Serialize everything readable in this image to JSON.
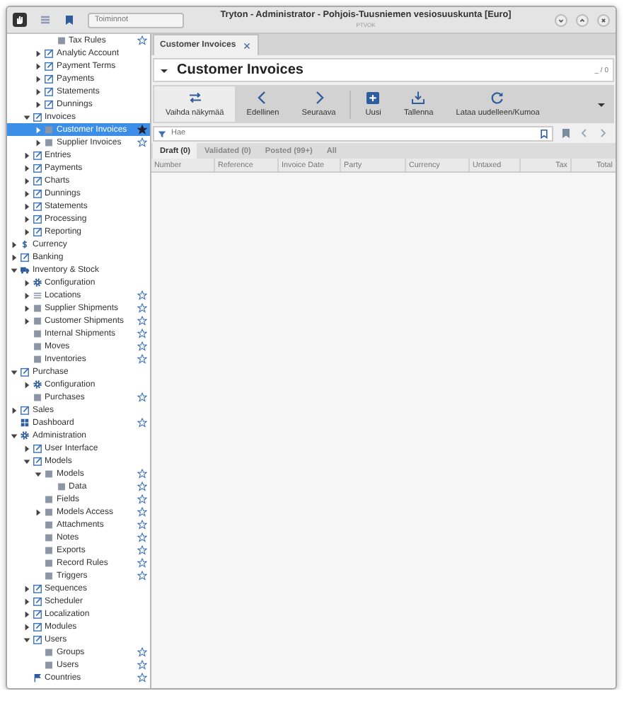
{
  "window": {
    "title": "Tryton - Administrator - Pohjois-Tuusniemen vesiosuuskunta [Euro]",
    "subtitle": "PTVOK",
    "search": {
      "placeholder": "Toiminnot"
    }
  },
  "sidebar": {
    "tree": [
      {
        "children": [
          {
            "children": [
              {
                "children": [
                  {
                    "label": "Tax Rules",
                    "kind": "list",
                    "selected": false,
                    "favorite": false
                  }
                ]
              },
              {
                "label": "Analytic Account",
                "kind": "form",
                "expanded": false,
                "selected": false
              },
              {
                "label": "Payment Terms",
                "kind": "form",
                "expanded": false,
                "selected": false
              },
              {
                "label": "Payments",
                "kind": "form",
                "expanded": false,
                "selected": false
              },
              {
                "label": "Statements",
                "kind": "form",
                "expanded": false,
                "selected": false
              },
              {
                "label": "Dunnings",
                "kind": "form",
                "expanded": false,
                "selected": false
              }
            ]
          },
          {
            "label": "Invoices",
            "kind": "form",
            "expanded": true,
            "selected": false,
            "children": [
              {
                "label": "Customer Invoices",
                "kind": "list",
                "expanded": false,
                "selected": true,
                "favorite": true
              },
              {
                "label": "Supplier Invoices",
                "kind": "list",
                "expanded": false,
                "selected": false,
                "favorite": false
              }
            ]
          },
          {
            "label": "Entries",
            "kind": "form",
            "expanded": false,
            "selected": false
          },
          {
            "label": "Payments",
            "kind": "form",
            "expanded": false,
            "selected": false
          },
          {
            "label": "Charts",
            "kind": "form",
            "expanded": false,
            "selected": false
          },
          {
            "label": "Dunnings",
            "kind": "form",
            "expanded": false,
            "selected": false
          },
          {
            "label": "Statements",
            "kind": "form",
            "expanded": false,
            "selected": false
          },
          {
            "label": "Processing",
            "kind": "form",
            "expanded": false,
            "selected": false
          },
          {
            "label": "Reporting",
            "kind": "form",
            "expanded": false,
            "selected": false
          }
        ]
      },
      {
        "label": "Currency",
        "kind": "dollar",
        "expanded": false,
        "selected": false
      },
      {
        "label": "Banking",
        "kind": "form",
        "expanded": false,
        "selected": false
      },
      {
        "label": "Inventory & Stock",
        "kind": "truck",
        "expanded": true,
        "selected": false,
        "children": [
          {
            "label": "Configuration",
            "kind": "gear",
            "expanded": false,
            "selected": false
          },
          {
            "label": "Locations",
            "kind": "lines",
            "expanded": false,
            "selected": false,
            "favorite": false
          },
          {
            "label": "Supplier Shipments",
            "kind": "list",
            "expanded": false,
            "selected": false,
            "favorite": false
          },
          {
            "label": "Customer Shipments",
            "kind": "list",
            "expanded": false,
            "selected": false,
            "favorite": false
          },
          {
            "label": "Internal Shipments",
            "kind": "list",
            "selected": false,
            "favorite": false
          },
          {
            "label": "Moves",
            "kind": "list",
            "selected": false,
            "favorite": false
          },
          {
            "label": "Inventories",
            "kind": "list",
            "selected": false,
            "favorite": false
          }
        ]
      },
      {
        "label": "Purchase",
        "kind": "form",
        "expanded": true,
        "selected": false,
        "children": [
          {
            "label": "Configuration",
            "kind": "gear",
            "expanded": false,
            "selected": false
          },
          {
            "label": "Purchases",
            "kind": "list",
            "selected": false,
            "favorite": false
          }
        ]
      },
      {
        "label": "Sales",
        "kind": "form",
        "expanded": false,
        "selected": false
      },
      {
        "label": "Dashboard",
        "kind": "grid",
        "selected": false,
        "favorite": false
      },
      {
        "label": "Administration",
        "kind": "gear",
        "expanded": true,
        "selected": false,
        "children": [
          {
            "label": "User Interface",
            "kind": "form",
            "expanded": false,
            "selected": false
          },
          {
            "label": "Models",
            "kind": "form",
            "expanded": true,
            "selected": false,
            "children": [
              {
                "label": "Models",
                "kind": "list",
                "expanded": true,
                "selected": false,
                "favorite": false,
                "children": [
                  {
                    "label": "Data",
                    "kind": "list",
                    "selected": false,
                    "favorite": false
                  }
                ]
              },
              {
                "label": "Fields",
                "kind": "list",
                "selected": false,
                "favorite": false
              },
              {
                "label": "Models Access",
                "kind": "list",
                "expanded": false,
                "selected": false,
                "favorite": false
              },
              {
                "label": "Attachments",
                "kind": "list",
                "selected": false,
                "favorite": false
              },
              {
                "label": "Notes",
                "kind": "list",
                "selected": false,
                "favorite": false
              },
              {
                "label": "Exports",
                "kind": "list",
                "selected": false,
                "favorite": false
              },
              {
                "label": "Record Rules",
                "kind": "list",
                "selected": false,
                "favorite": false
              },
              {
                "label": "Triggers",
                "kind": "list",
                "selected": false,
                "favorite": false
              }
            ]
          },
          {
            "label": "Sequences",
            "kind": "form",
            "expanded": false,
            "selected": false
          },
          {
            "label": "Scheduler",
            "kind": "form",
            "expanded": false,
            "selected": false
          },
          {
            "label": "Localization",
            "kind": "form",
            "expanded": false,
            "selected": false
          },
          {
            "label": "Modules",
            "kind": "form",
            "expanded": false,
            "selected": false
          },
          {
            "label": "Users",
            "kind": "form",
            "expanded": true,
            "selected": false,
            "children": [
              {
                "label": "Groups",
                "kind": "list",
                "selected": false,
                "favorite": false
              },
              {
                "label": "Users",
                "kind": "list",
                "selected": false,
                "favorite": false
              }
            ]
          },
          {
            "label": "Countries",
            "kind": "flag",
            "selected": false,
            "favorite": false
          }
        ]
      }
    ]
  },
  "tabs": [
    {
      "label": "Customer Invoices",
      "selected": true
    }
  ],
  "view": {
    "title": "Customer Invoices",
    "record_count": "_ / 0",
    "toolbar": [
      {
        "kind": "switch",
        "label": "Vaihda näkymää",
        "highlighted": true
      },
      {
        "kind": "previous",
        "label": "Edellinen",
        "highlighted": false
      },
      {
        "kind": "next",
        "label": "Seuraava",
        "highlighted": false
      },
      {
        "kind": "new",
        "label": "Uusi",
        "highlighted": false
      },
      {
        "kind": "save",
        "label": "Tallenna",
        "highlighted": false
      },
      {
        "kind": "reload",
        "label": "Lataa uudelleen/Kumoa",
        "highlighted": false
      }
    ],
    "search": {
      "placeholder": "Hae"
    },
    "filters": [
      {
        "label": "Draft (0)",
        "selected": true
      },
      {
        "label": "Validated (0)",
        "selected": false
      },
      {
        "label": "Posted (99+)",
        "selected": false
      },
      {
        "label": "All",
        "selected": false
      }
    ],
    "table": {
      "columns": [
        "Number",
        "Reference",
        "Invoice Date",
        "Party",
        "Currency",
        "Untaxed",
        "Tax",
        "Total"
      ]
    }
  }
}
